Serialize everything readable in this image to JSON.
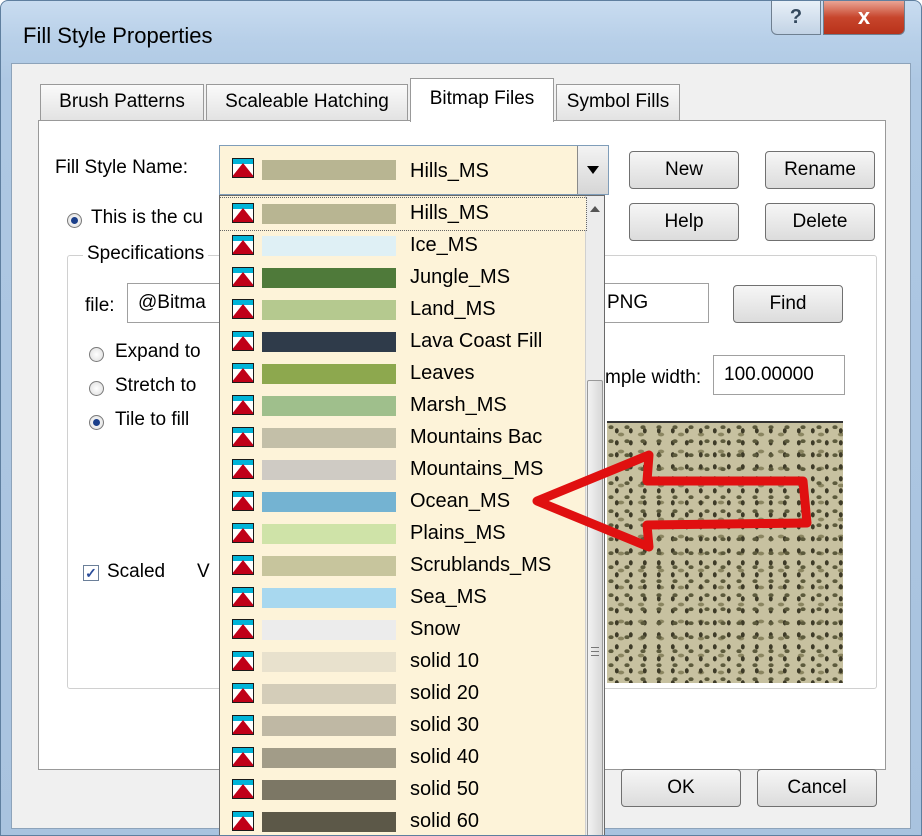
{
  "window": {
    "title": "Fill Style Properties",
    "help_label": "?",
    "close_label": "x"
  },
  "tabs": [
    {
      "label": "Brush Patterns"
    },
    {
      "label": "Scaleable Hatching"
    },
    {
      "label": "Bitmap Files"
    },
    {
      "label": "Symbol Fills"
    }
  ],
  "fill_style": {
    "label": "Fill Style Name:",
    "selected": "Hills_MS"
  },
  "buttons": {
    "new": "New",
    "rename": "Rename",
    "help": "Help",
    "delete": "Delete",
    "find": "Find",
    "ok": "OK",
    "cancel": "Cancel"
  },
  "current_radio_label": "This is the cu",
  "specs": {
    "group_label": "Specifications",
    "file_label": "file:",
    "file_value": "@Bitma",
    "file_suffix": "PNG",
    "expand_label": "Expand to",
    "stretch_label": "Stretch to",
    "tile_label": "Tile to fill",
    "sample_width_label": "mple width:",
    "sample_width_value": "100.00000",
    "scaled_label": "Scaled",
    "scaled_extra": "V"
  },
  "dropdown_items": [
    {
      "name": "Hills_MS",
      "color": "#b8b592"
    },
    {
      "name": "Ice_MS",
      "color": "#dff0f5"
    },
    {
      "name": "Jungle_MS",
      "color": "#4f7a3a"
    },
    {
      "name": "Land_MS",
      "color": "#b5c98f"
    },
    {
      "name": "Lava Coast Fill",
      "color": "#2f3b4a"
    },
    {
      "name": "Leaves",
      "color": "#8da84e"
    },
    {
      "name": "Marsh_MS",
      "color": "#9fbf8c"
    },
    {
      "name": "Mountains Bac",
      "color": "#c3bfa8"
    },
    {
      "name": "Mountains_MS",
      "color": "#cfcbc4"
    },
    {
      "name": "Ocean_MS",
      "color": "#74b3d2"
    },
    {
      "name": "Plains_MS",
      "color": "#cfe3a8"
    },
    {
      "name": "Scrublands_MS",
      "color": "#c7c59d"
    },
    {
      "name": "Sea_MS",
      "color": "#a8d8ef"
    },
    {
      "name": "Snow",
      "color": "#ececec"
    },
    {
      "name": "solid 10",
      "color": "#e8e1cd"
    },
    {
      "name": "solid 20",
      "color": "#d4cdb9"
    },
    {
      "name": "solid 30",
      "color": "#bfb8a4"
    },
    {
      "name": "solid 40",
      "color": "#a29c88"
    },
    {
      "name": "solid 50",
      "color": "#7c7765"
    },
    {
      "name": "solid 60",
      "color": "#5c5848"
    }
  ],
  "colors": {
    "accent_arrow": "#e01010",
    "dropdown_bg": "#fdf3d9"
  }
}
